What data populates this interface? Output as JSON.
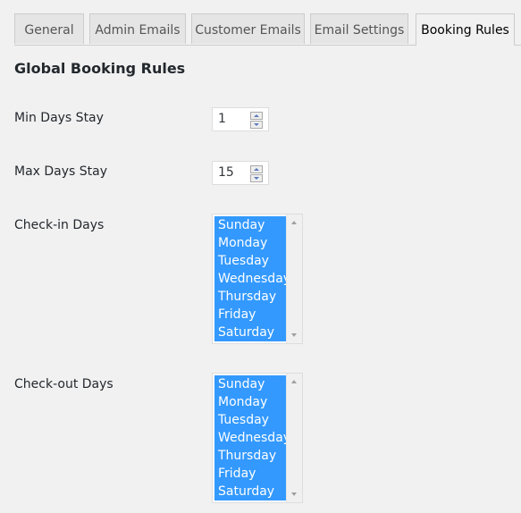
{
  "tabs": [
    {
      "label": "General",
      "active": false
    },
    {
      "label": "Admin Emails",
      "active": false
    },
    {
      "label": "Customer Emails",
      "active": false
    },
    {
      "label": "Email Settings",
      "active": false
    },
    {
      "label": "Booking Rules",
      "active": true
    }
  ],
  "heading": "Global Booking Rules",
  "fields": {
    "min_days": {
      "label": "Min Days Stay",
      "value": "1"
    },
    "max_days": {
      "label": "Max Days Stay",
      "value": "15"
    },
    "checkin": {
      "label": "Check-in Days",
      "options": [
        "Sunday",
        "Monday",
        "Tuesday",
        "Wednesday",
        "Thursday",
        "Friday",
        "Saturday"
      ],
      "selected": [
        "Sunday",
        "Monday",
        "Tuesday",
        "Wednesday",
        "Thursday",
        "Friday",
        "Saturday"
      ]
    },
    "checkout": {
      "label": "Check-out Days",
      "options": [
        "Sunday",
        "Monday",
        "Tuesday",
        "Wednesday",
        "Thursday",
        "Friday",
        "Saturday"
      ],
      "selected": [
        "Sunday",
        "Monday",
        "Tuesday",
        "Wednesday",
        "Thursday",
        "Friday",
        "Saturday"
      ]
    }
  },
  "colors": {
    "selection": "#3399ff",
    "background": "#f1f1f1"
  }
}
